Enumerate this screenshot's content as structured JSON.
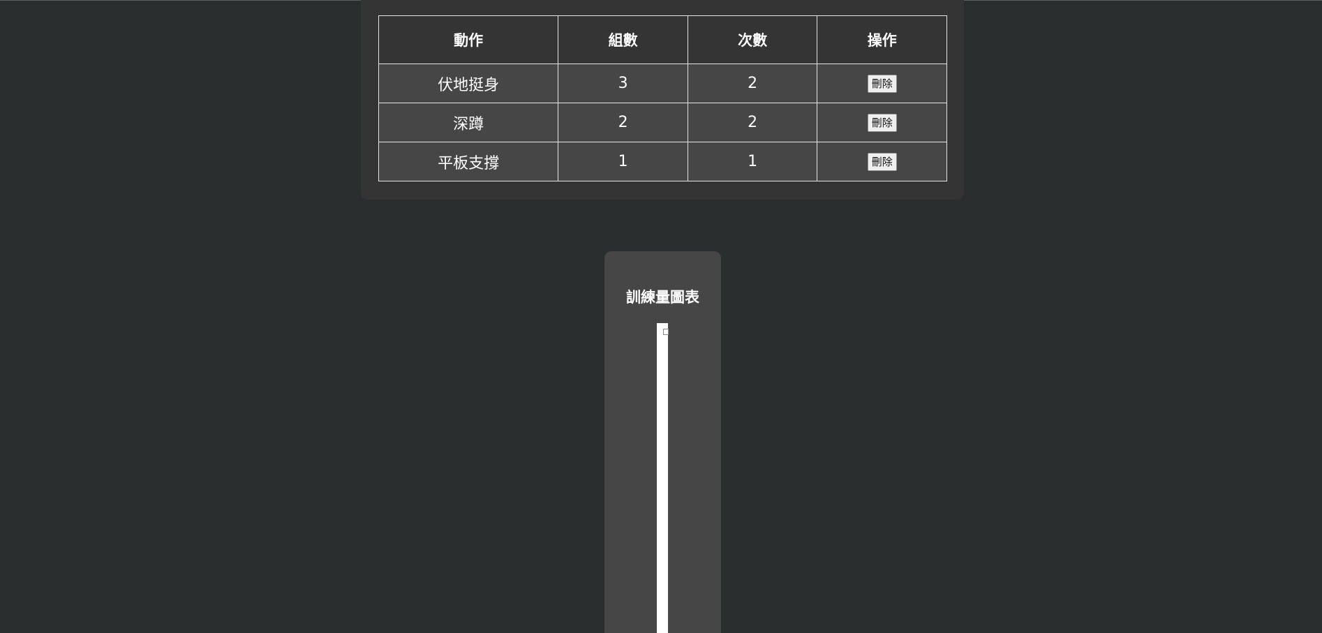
{
  "table": {
    "headers": [
      "動作",
      "組數",
      "次數",
      "操作"
    ],
    "rows": [
      {
        "action": "伏地挺身",
        "sets": "3",
        "reps": "2",
        "button": "刪除"
      },
      {
        "action": "深蹲",
        "sets": "2",
        "reps": "2",
        "button": "刪除"
      },
      {
        "action": "平板支撐",
        "sets": "1",
        "reps": "1",
        "button": "刪除"
      }
    ]
  },
  "chart": {
    "title": "訓練量圖表"
  },
  "colors": {
    "page_background": "#2a2e2f",
    "card_background": "#353434",
    "row_background": "#464646",
    "chart_card_background": "#464646",
    "text": "#ffffff"
  }
}
